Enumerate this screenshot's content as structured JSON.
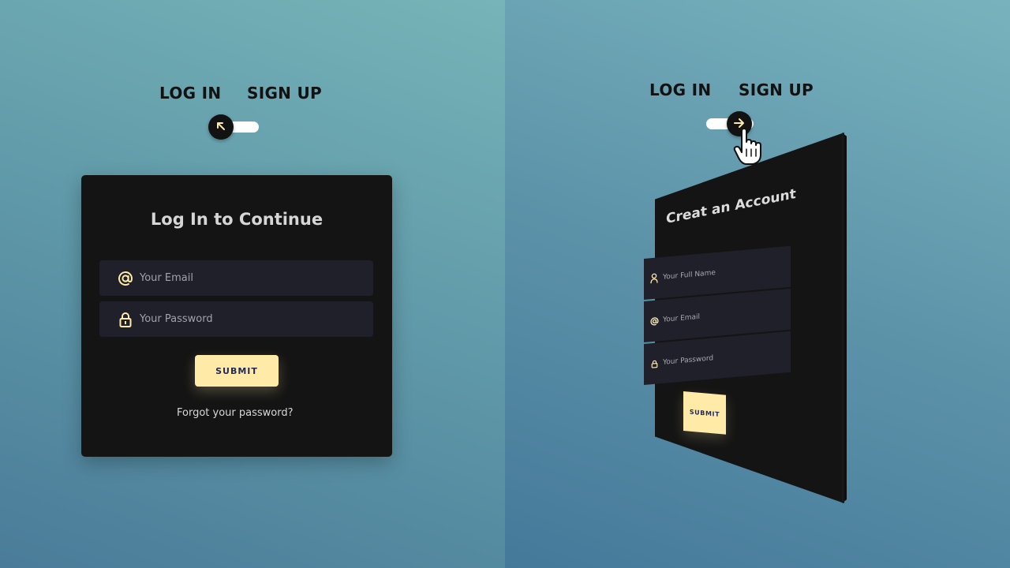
{
  "left_panel": {
    "tabs": {
      "login_label": "LOG IN",
      "signup_label": "SIGN UP"
    },
    "toggle": {
      "state": "log-in",
      "knob_icon": "arrow-up-left-icon"
    },
    "card": {
      "title": "Log In to Continue",
      "email_placeholder": "Your Email",
      "password_placeholder": "Your Password",
      "submit_label": "SUBMIT",
      "forgot_link": "Forgot your password?"
    }
  },
  "right_panel": {
    "tabs": {
      "login_label": "LOG IN",
      "signup_label": "SIGN UP"
    },
    "toggle": {
      "state": "sign-up",
      "knob_icon": "arrow-right-icon"
    },
    "card": {
      "title": "Creat an Account",
      "fullname_placeholder": "Your Full Name",
      "email_placeholder": "Your Email",
      "password_placeholder": "Your Password",
      "submit_label": "SUBMIT"
    },
    "cursor": "pointer-hand-icon"
  },
  "colors": {
    "card_background": "#141414",
    "field_background": "#20202b",
    "accent_yellow": "#ffeba7",
    "button_text": "#1f2a5b",
    "page_gradient_start": "#4a7c99",
    "page_gradient_end": "#76b4b8"
  }
}
